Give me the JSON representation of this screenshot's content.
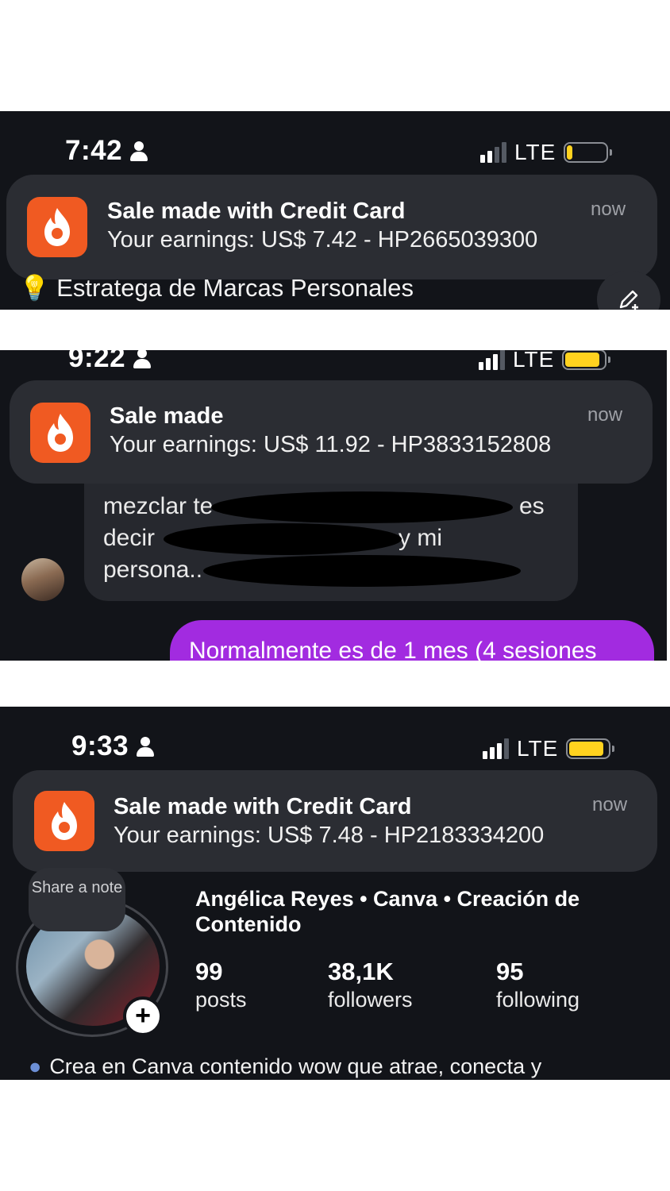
{
  "screens": [
    {
      "status": {
        "time": "7:42",
        "network": "LTE",
        "battery_level": 0.15
      },
      "notification": {
        "title": "Sale made with Credit Card",
        "body": "Your earnings: US$ 7.42 - HP2665039300",
        "time": "now",
        "app_icon": "hotmart-flame-icon"
      },
      "bio_line": "Estratega de Marcas Personales"
    },
    {
      "status": {
        "time": "9:22",
        "network": "LTE",
        "battery_level": 0.9
      },
      "notification": {
        "title": "Sale made",
        "body": "Your earnings: US$ 11.92 - HP3833152808",
        "time": "now",
        "app_icon": "hotmart-flame-icon"
      },
      "chat": {
        "received_lines": [
          "mezclar te",
          "es",
          "decir",
          "y mi",
          "persona.."
        ],
        "sent_message": "Normalmente es de 1 mes (4 sesiones"
      }
    },
    {
      "status": {
        "time": "9:33",
        "network": "LTE",
        "battery_level": 0.9
      },
      "notification": {
        "title": "Sale made with Credit Card",
        "body": "Your earnings: US$ 7.48 - HP2183334200",
        "time": "now",
        "app_icon": "hotmart-flame-icon"
      },
      "profile": {
        "note_label": "Share a note",
        "name": "Angélica Reyes • Canva • Creación de Contenido",
        "stats": [
          {
            "value": "99",
            "label": "posts"
          },
          {
            "value": "38,1K",
            "label": "followers"
          },
          {
            "value": "95",
            "label": "following"
          }
        ],
        "bio": "Crea en Canva contenido wow que atrae, conecta y"
      }
    }
  ],
  "colors": {
    "accent_orange": "#f05a22",
    "sent_bubble": "#a22be0",
    "battery_yellow": "#ffd21f"
  }
}
